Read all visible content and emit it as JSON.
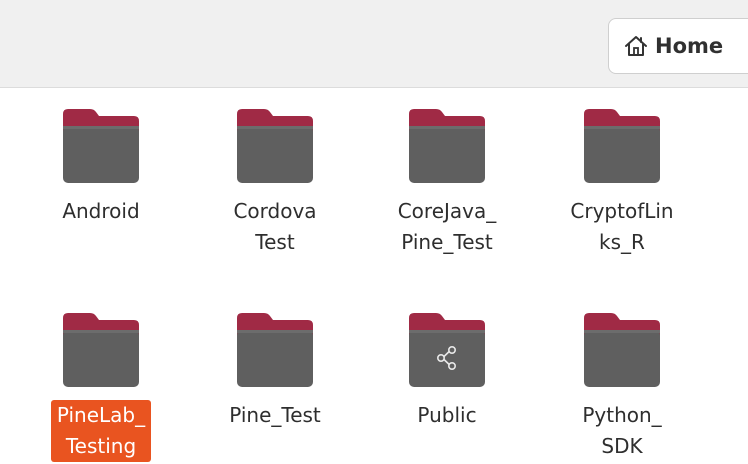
{
  "header": {
    "path_button_label": "Home"
  },
  "colors": {
    "folder_body": "#616161",
    "folder_tab": "#a02a45",
    "selection": "#e95420"
  },
  "icons": {
    "home": "home-icon",
    "folder": "folder-icon",
    "share": "share-icon"
  },
  "items": [
    {
      "label": "Android",
      "icon": "folder-icon",
      "selected": false
    },
    {
      "label": "Cordova\nTest",
      "icon": "folder-icon",
      "selected": false
    },
    {
      "label": "CoreJava_\nPine_Test",
      "icon": "folder-icon",
      "selected": false
    },
    {
      "label": "CryptofLin\nks_R",
      "icon": "folder-icon",
      "selected": false
    },
    {
      "label": "PineLab_\nTesting",
      "icon": "folder-icon",
      "selected": true
    },
    {
      "label": "Pine_Test",
      "icon": "folder-icon",
      "selected": false
    },
    {
      "label": "Public",
      "icon": "share-icon",
      "selected": false
    },
    {
      "label": "Python_\nSDK",
      "icon": "folder-icon",
      "selected": false
    }
  ]
}
